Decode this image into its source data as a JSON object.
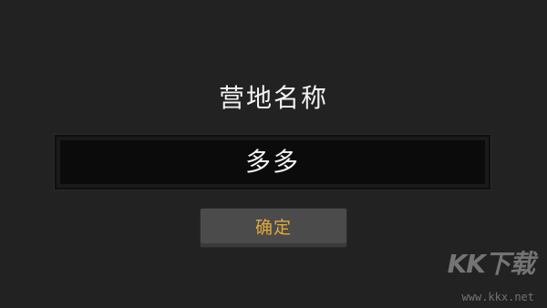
{
  "dialog": {
    "title": "营地名称",
    "name_value": "多多",
    "confirm_label": "确定"
  },
  "watermark": {
    "logo_text": "KK下载",
    "url": "www.kkx.net"
  },
  "colors": {
    "background": "#222222",
    "field_background": "#0b0b0b",
    "button_background": "#4b4b4b",
    "button_text": "#e2a93c",
    "text": "#f2f2f2"
  }
}
